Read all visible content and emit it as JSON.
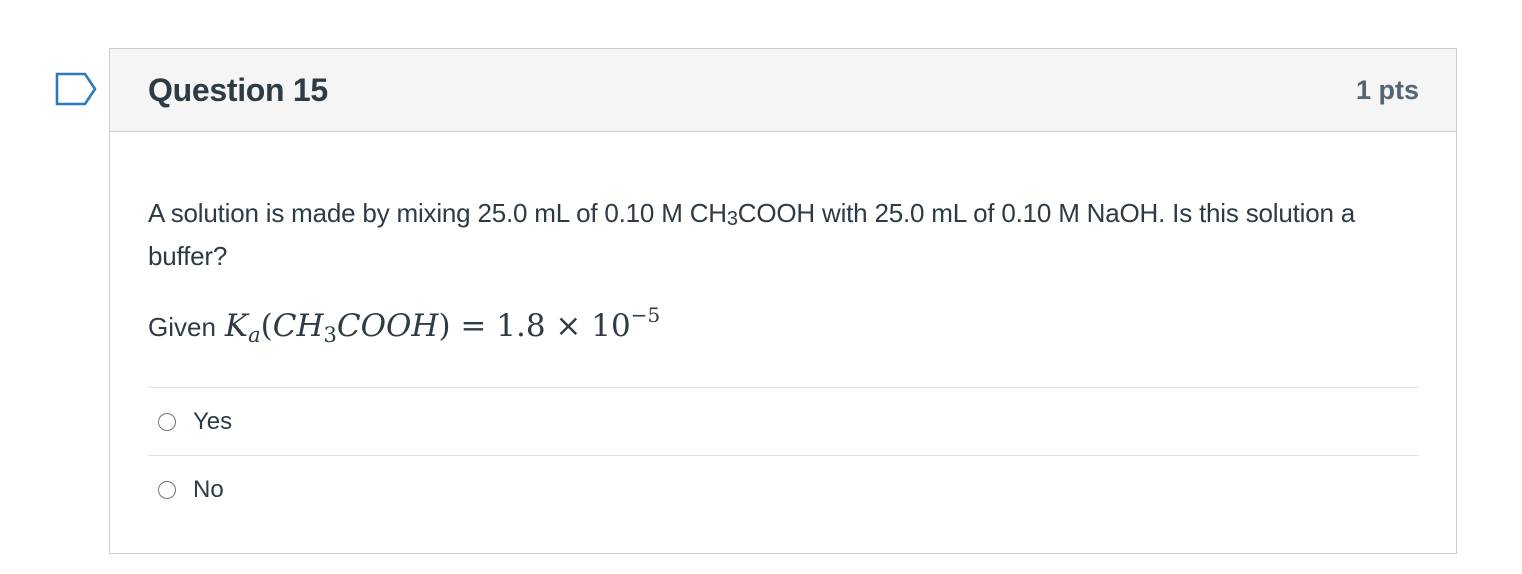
{
  "question": {
    "title": "Question 15",
    "points": "1 pts",
    "text_part1": "A solution is made by mixing 25.0 mL of 0.10 M CH",
    "text_sub": "3",
    "text_part2": "COOH with 25.0 mL of 0.10 M NaOH. Is this solution a buffer?",
    "given_label": "Given",
    "math": {
      "k": "K",
      "k_sub": "a",
      "open": "(",
      "ch": "CH",
      "ch_sub": "3",
      "cooh": "COOH",
      "close": ")",
      "rest": " = 1.8 × 10",
      "exp": "−5"
    },
    "answers": [
      {
        "label": "Yes"
      },
      {
        "label": "No"
      }
    ]
  }
}
